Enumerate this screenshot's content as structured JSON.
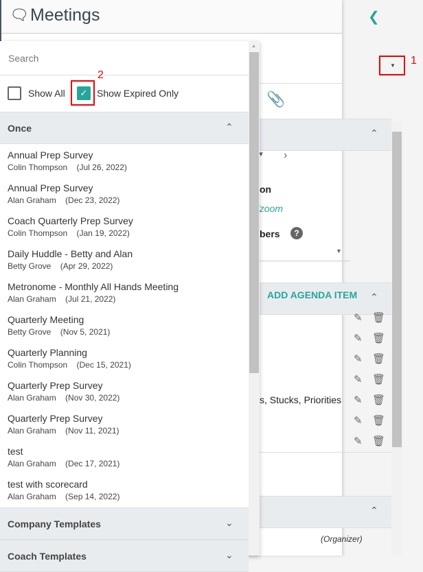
{
  "header": {
    "title": "Meetings",
    "collapse_icon": "chevron-left-icon"
  },
  "popup": {
    "search_placeholder": "Search",
    "show_all": {
      "label": "Show All",
      "checked": false
    },
    "show_expired": {
      "label": "Show Expired Only",
      "checked": true
    },
    "groups": [
      {
        "label": "Once",
        "expanded": true
      },
      {
        "label": "Company Templates",
        "expanded": false
      },
      {
        "label": "Coach Templates",
        "expanded": false
      }
    ],
    "items": [
      {
        "name": "Annual Prep Survey",
        "owner": "Colin Thompson",
        "date": "(Jul 26, 2022)"
      },
      {
        "name": "Annual Prep Survey",
        "owner": "Alan Graham",
        "date": "(Dec 23, 2022)"
      },
      {
        "name": "Coach Quarterly Prep Survey",
        "owner": "Colin Thompson",
        "date": "(Jan 19, 2022)"
      },
      {
        "name": "Daily Huddle - Betty and Alan",
        "owner": "Betty Grove",
        "date": "(Apr 29, 2022)"
      },
      {
        "name": "Metronome - Monthly All Hands Meeting",
        "owner": "Alan Graham",
        "date": "(Jul 21, 2022)"
      },
      {
        "name": "Quarterly Meeting",
        "owner": "Betty Grove",
        "date": "(Nov 5, 2021)"
      },
      {
        "name": "Quarterly Planning",
        "owner": "Colin Thompson",
        "date": "(Dec 15, 2021)"
      },
      {
        "name": "Quarterly Prep Survey",
        "owner": "Alan Graham",
        "date": "(Nov 30, 2022)"
      },
      {
        "name": "Quarterly Prep Survey",
        "owner": "Alan Graham",
        "date": "(Nov 11, 2021)"
      },
      {
        "name": "test",
        "owner": "Alan Graham",
        "date": "(Dec 17, 2021)"
      },
      {
        "name": "test with scorecard",
        "owner": "Alan Graham",
        "date": "(Sep 14, 2022)"
      }
    ]
  },
  "background": {
    "location_label": "on",
    "location_link": "//zoom",
    "members_label": "bers",
    "add_agenda": "ADD AGENDA ITEM",
    "agenda_partial": "s, Stucks, Priorities",
    "organizer": "(Organizer)"
  },
  "annotations": {
    "one": "1",
    "two": "2"
  },
  "colors": {
    "accent": "#26a69a",
    "annotation": "#ee0000"
  }
}
